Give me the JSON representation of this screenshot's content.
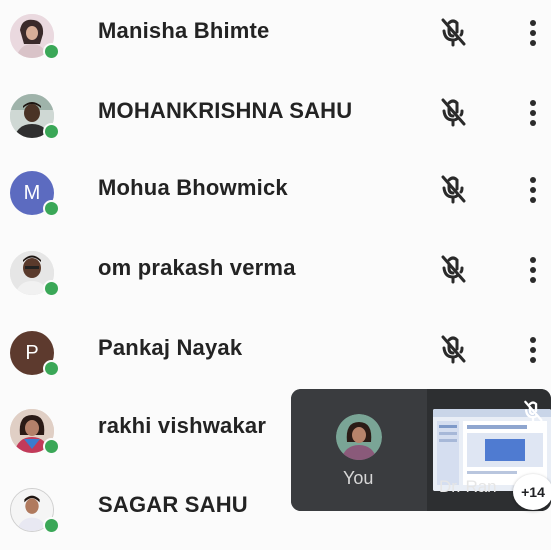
{
  "participants": [
    {
      "name": "Manisha Bhimte",
      "avatar_type": "photo",
      "mic_icon": "mic-off-icon",
      "online": true
    },
    {
      "name": "MOHANKRISHNA SAHU",
      "avatar_type": "photo",
      "mic_icon": "mic-off-icon",
      "online": true
    },
    {
      "name": "Mohua Bhowmick",
      "avatar_type": "letter",
      "avatar_letter": "M",
      "avatar_color": "#5c6bc0",
      "mic_icon": "mic-off-icon",
      "online": true
    },
    {
      "name": "om prakash verma",
      "avatar_type": "photo",
      "mic_icon": "mic-off-icon",
      "online": true
    },
    {
      "name": "Pankaj Nayak",
      "avatar_type": "letter",
      "avatar_letter": "P",
      "avatar_color": "#5d3a2e",
      "mic_icon": "mic-off-icon",
      "online": true
    },
    {
      "name": "rakhi vishwakar",
      "avatar_type": "photo",
      "online": true
    },
    {
      "name": "SAGAR SAHU",
      "avatar_type": "photo",
      "online": true
    }
  ],
  "pip": {
    "self_label": "You",
    "share_label": "Dr. Ran",
    "others_count": "+14"
  },
  "colors": {
    "presence": "#3aa757",
    "pip_background": "#3b3d40"
  }
}
